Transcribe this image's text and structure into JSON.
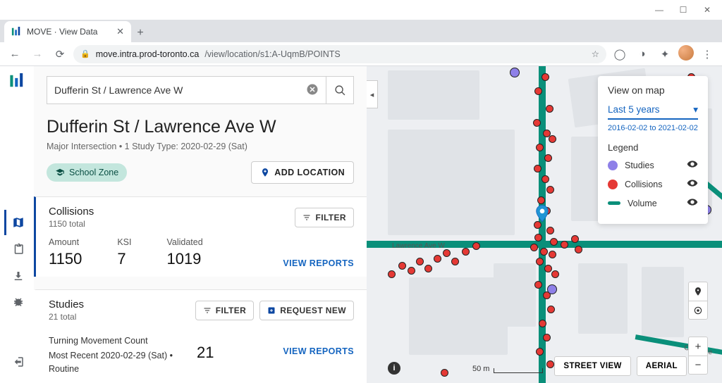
{
  "window": {
    "title": "MOVE · View Data"
  },
  "browser": {
    "url_host": "move.intra.prod-toronto.ca",
    "url_path": "/view/location/s1:A-UqmB/POINTS"
  },
  "search": {
    "value": "Dufferin St / Lawrence Ave W"
  },
  "page": {
    "title": "Dufferin St / Lawrence Ave W",
    "subtitle": "Major Intersection • 1 Study Type: 2020-02-29 (Sat)",
    "chip": "School Zone",
    "add_location": "ADD LOCATION"
  },
  "collisions": {
    "heading": "Collisions",
    "total": "1150 total",
    "filter": "FILTER",
    "stats": [
      {
        "label": "Amount",
        "value": "1150"
      },
      {
        "label": "KSI",
        "value": "7"
      },
      {
        "label": "Validated",
        "value": "1019"
      }
    ],
    "view_reports": "VIEW REPORTS"
  },
  "studies": {
    "heading": "Studies",
    "total": "21 total",
    "filter": "FILTER",
    "request_new": "REQUEST NEW",
    "type": "Turning Movement Count",
    "recent": "Most Recent 2020-02-29 (Sat) • Routine",
    "count": "21",
    "view_reports": "VIEW REPORTS"
  },
  "legend": {
    "title": "View on map",
    "range_label": "Last 5 years",
    "date_range": "2016-02-02 to 2021-02-02",
    "legend_label": "Legend",
    "items": [
      {
        "label": "Studies",
        "color": "#8e80e8"
      },
      {
        "label": "Collisions",
        "color": "#e53935"
      },
      {
        "label": "Volume",
        "color": "#0a8f7a"
      }
    ]
  },
  "map": {
    "scale": "50 m",
    "street_label": "Lawrence Ave W",
    "other_label": "Cork Ave",
    "street_view": "STREET VIEW",
    "aerial": "AERIAL"
  }
}
